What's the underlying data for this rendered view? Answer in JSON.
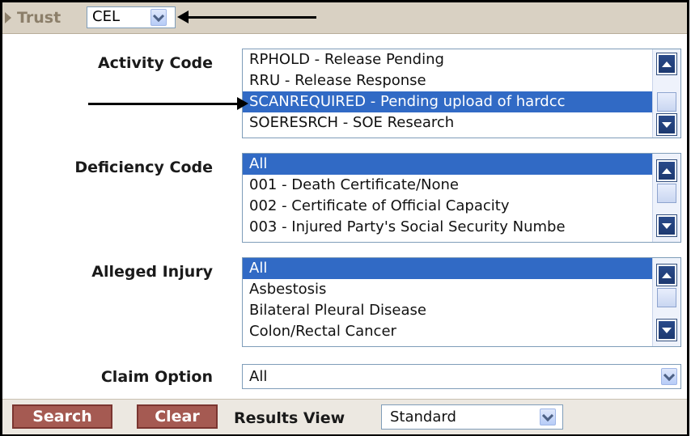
{
  "trust": {
    "label": "Trust",
    "value": "CEL"
  },
  "activity_code": {
    "label": "Activity Code",
    "options": [
      {
        "text": "RPHOLD - Release Pending",
        "selected": false
      },
      {
        "text": "RRU - Release Response",
        "selected": false
      },
      {
        "text": "SCANREQUIRED - Pending upload of hardcc",
        "selected": true
      },
      {
        "text": "SOERESRCH - SOE Research",
        "selected": false
      }
    ]
  },
  "deficiency_code": {
    "label": "Deficiency Code",
    "options": [
      {
        "text": "All",
        "selected": true
      },
      {
        "text": "001 - Death Certificate/None",
        "selected": false
      },
      {
        "text": "002 - Certificate of Official Capacity",
        "selected": false
      },
      {
        "text": "003 - Injured Party's Social Security Numbe",
        "selected": false
      }
    ]
  },
  "alleged_injury": {
    "label": "Alleged Injury",
    "options": [
      {
        "text": "All",
        "selected": true
      },
      {
        "text": "Asbestosis",
        "selected": false
      },
      {
        "text": "Bilateral Pleural Disease",
        "selected": false
      },
      {
        "text": "Colon/Rectal Cancer",
        "selected": false
      }
    ]
  },
  "claim_option": {
    "label": "Claim Option",
    "value": "All"
  },
  "footer": {
    "search_label": "Search",
    "clear_label": "Clear",
    "results_view_label": "Results View",
    "results_view_value": "Standard"
  },
  "colors": {
    "header_bg": "#d9d1c3",
    "selection": "#316ac5",
    "button_red": "#a55a52",
    "scroll_button": "#1d3970"
  }
}
